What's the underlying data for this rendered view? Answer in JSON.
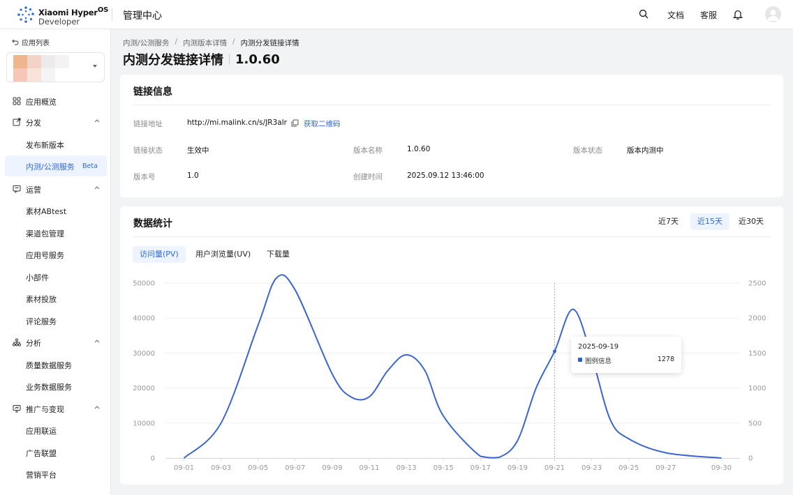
{
  "topbar": {
    "brand_line1": "Xiaomi Hyper",
    "brand_sup": "OS",
    "brand_line2": "Developer",
    "title": "管理中心",
    "docs": "文档",
    "support": "客服"
  },
  "sidebar": {
    "back_label": "应用列表",
    "items": [
      {
        "label": "应用概览",
        "icon": "grid-icon",
        "top": 0
      },
      {
        "label": "分发",
        "icon": "share-icon",
        "chevron": true
      },
      {
        "label": "发布新版本"
      },
      {
        "label": "内测/公测服务",
        "badge": "Beta",
        "active": true
      },
      {
        "label": "运营",
        "icon": "chat-icon",
        "chevron": true
      },
      {
        "label": "素材ABtest"
      },
      {
        "label": "渠道包管理"
      },
      {
        "label": "应用号服务"
      },
      {
        "label": "小部件"
      },
      {
        "label": "素材投放"
      },
      {
        "label": "评论服务"
      },
      {
        "label": "分析",
        "icon": "sitemap-icon",
        "chevron": true
      },
      {
        "label": "质量数据服务"
      },
      {
        "label": "业务数据服务"
      },
      {
        "label": "推广与变现",
        "icon": "promo-icon",
        "chevron": true
      },
      {
        "label": "应用联运"
      },
      {
        "label": "广告联盟"
      },
      {
        "label": "营销平台"
      }
    ]
  },
  "breadcrumb": [
    "内测/公测服务",
    "内测版本详情",
    "内测分发链接详情"
  ],
  "page_title": {
    "main": "内测分发链接详情",
    "version": "1.0.60"
  },
  "link_info": {
    "title": "链接信息",
    "address_label": "链接地址",
    "address_value": "http://mi.malink.cn/s/JR3alr",
    "qr_label": "获取二维码",
    "status_label": "链接状态",
    "status_value": "生效中",
    "version_name_label": "版本名称",
    "version_name_value": "1.0.60",
    "version_state_label": "版本状态",
    "version_state_value": "版本内测中",
    "version_code_label": "版本号",
    "version_code_value": "1.0",
    "created_label": "创建时间",
    "created_value": "2025.09.12 13:46:00"
  },
  "stats": {
    "title": "数据统计",
    "ranges": [
      "近7天",
      "近15天",
      "近30天"
    ],
    "active_range": 1,
    "metrics": [
      "访问量(PV)",
      "用户浏览量(UV)",
      "下载量"
    ],
    "active_metric": 0,
    "tooltip": {
      "date": "2025-09-19",
      "series": "图例信息",
      "value": "1278"
    }
  },
  "colors": {
    "accent": "#2f6bd9",
    "line": "#3a66cc"
  },
  "chart_data": {
    "type": "line",
    "x_tick_labels": [
      "09-01",
      "09-03",
      "09-05",
      "09-07",
      "09-09",
      "09-11",
      "09-13",
      "09-15",
      "09-17",
      "09-19",
      "09-21",
      "09-23",
      "09-25",
      "09-27",
      "09-30"
    ],
    "y_left_ticks": [
      "0",
      "10000",
      "20000",
      "30000",
      "40000",
      "50000"
    ],
    "y_right_ticks": [
      "0",
      "500",
      "1000",
      "1500",
      "2000",
      "2500"
    ],
    "ylim_left": [
      0,
      50000
    ],
    "ylim_right": [
      0,
      2500
    ],
    "grid": true,
    "series": [
      {
        "x": [
          "09-01",
          "09-03",
          "09-05",
          "09-06",
          "09-07",
          "09-09",
          "09-10",
          "09-11",
          "09-12",
          "09-13",
          "09-14",
          "09-15",
          "09-17",
          "09-18",
          "09-19",
          "09-20",
          "09-21",
          "09-22",
          "09-23",
          "09-24",
          "09-25",
          "09-27",
          "09-30"
        ],
        "values": [
          0,
          10000,
          38000,
          51500,
          48000,
          24000,
          17500,
          17500,
          25000,
          29500,
          25000,
          12000,
          500,
          200,
          5000,
          20000,
          30500,
          42500,
          29000,
          11000,
          5500,
          1500,
          0
        ]
      }
    ]
  }
}
